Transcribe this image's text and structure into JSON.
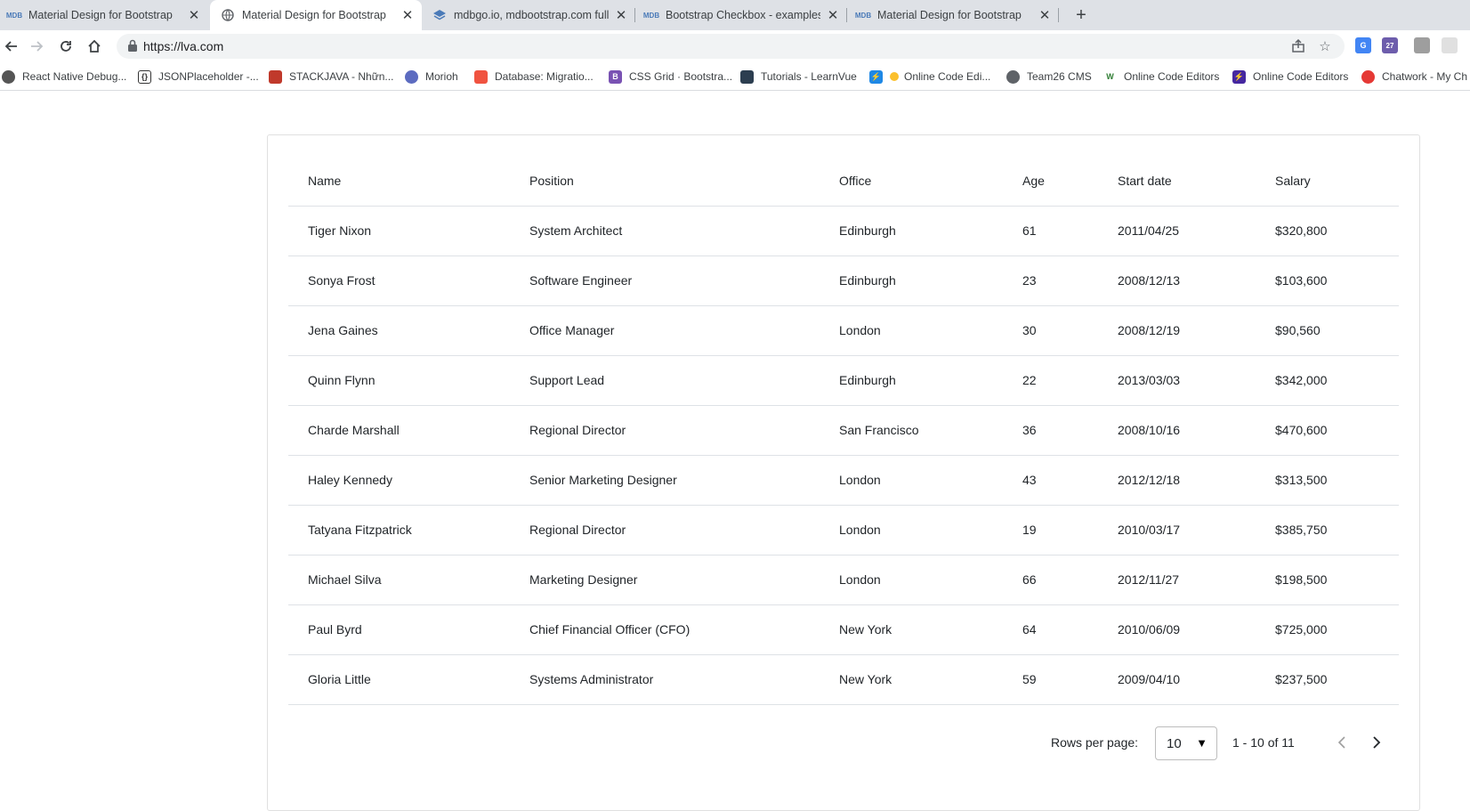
{
  "browser": {
    "tabs": [
      {
        "title": "Material Design for Bootstrap",
        "favicon": "mdb-logo-icon",
        "active": false
      },
      {
        "title": "Material Design for Bootstrap",
        "favicon": "globe-icon",
        "active": true
      },
      {
        "title": "mdbgo.io, mdbootstrap.com full",
        "favicon": "stack-icon",
        "active": false
      },
      {
        "title": "Bootstrap Checkbox - examples &",
        "favicon": "mdb-logo-icon",
        "active": false
      },
      {
        "title": "Material Design for Bootstrap",
        "favicon": "mdb-logo-icon",
        "active": false
      }
    ],
    "favicon_text": "MDB",
    "url": "https://lva.com",
    "extension_badge": "27",
    "bookmarks": [
      {
        "label": "React Native Debug...",
        "icon": "react-icon",
        "color": "#555555"
      },
      {
        "label": "JSONPlaceholder -...",
        "icon": "json-icon",
        "color": "#333333"
      },
      {
        "label": "STACKJAVA - Nhữn...",
        "icon": "stackjava-icon",
        "color": "#c0392b"
      },
      {
        "label": "Morioh",
        "icon": "morioh-icon",
        "color": "#5c6bc0"
      },
      {
        "label": "Database: Migratio...",
        "icon": "laravel-icon",
        "color": "#f05340"
      },
      {
        "label": "CSS Grid · Bootstra...",
        "icon": "bootstrap-icon",
        "color": "#7952b3"
      },
      {
        "label": "Tutorials - LearnVue",
        "icon": "learnvue-icon",
        "color": "#2c3e50"
      },
      {
        "label": "Online Code Edi...",
        "icon": "bolt-icon",
        "color": "#1e88e5"
      },
      {
        "label": "Team26 CMS",
        "icon": "globe-icon",
        "color": "#5f6368"
      },
      {
        "label": "Online Code Editors",
        "icon": "w-icon",
        "color": "#2e7d32"
      },
      {
        "label": "Online Code Editors",
        "icon": "bolt-icon",
        "color": "#4527a0"
      },
      {
        "label": "Chatwork - My Ch",
        "icon": "chatwork-icon",
        "color": "#e53935"
      }
    ]
  },
  "table": {
    "columns": [
      "Name",
      "Position",
      "Office",
      "Age",
      "Start date",
      "Salary"
    ],
    "rows": [
      [
        "Tiger Nixon",
        "System Architect",
        "Edinburgh",
        "61",
        "2011/04/25",
        "$320,800"
      ],
      [
        "Sonya Frost",
        "Software Engineer",
        "Edinburgh",
        "23",
        "2008/12/13",
        "$103,600"
      ],
      [
        "Jena Gaines",
        "Office Manager",
        "London",
        "30",
        "2008/12/19",
        "$90,560"
      ],
      [
        "Quinn Flynn",
        "Support Lead",
        "Edinburgh",
        "22",
        "2013/03/03",
        "$342,000"
      ],
      [
        "Charde Marshall",
        "Regional Director",
        "San Francisco",
        "36",
        "2008/10/16",
        "$470,600"
      ],
      [
        "Haley Kennedy",
        "Senior Marketing Designer",
        "London",
        "43",
        "2012/12/18",
        "$313,500"
      ],
      [
        "Tatyana Fitzpatrick",
        "Regional Director",
        "London",
        "19",
        "2010/03/17",
        "$385,750"
      ],
      [
        "Michael Silva",
        "Marketing Designer",
        "London",
        "66",
        "2012/11/27",
        "$198,500"
      ],
      [
        "Paul Byrd",
        "Chief Financial Officer (CFO)",
        "New York",
        "64",
        "2010/06/09",
        "$725,000"
      ],
      [
        "Gloria Little",
        "Systems Administrator",
        "New York",
        "59",
        "2009/04/10",
        "$237,500"
      ]
    ]
  },
  "pagination": {
    "rows_per_page_label": "Rows per page:",
    "rows_per_page_value": "10",
    "range_text": "1 - 10 of 11"
  }
}
